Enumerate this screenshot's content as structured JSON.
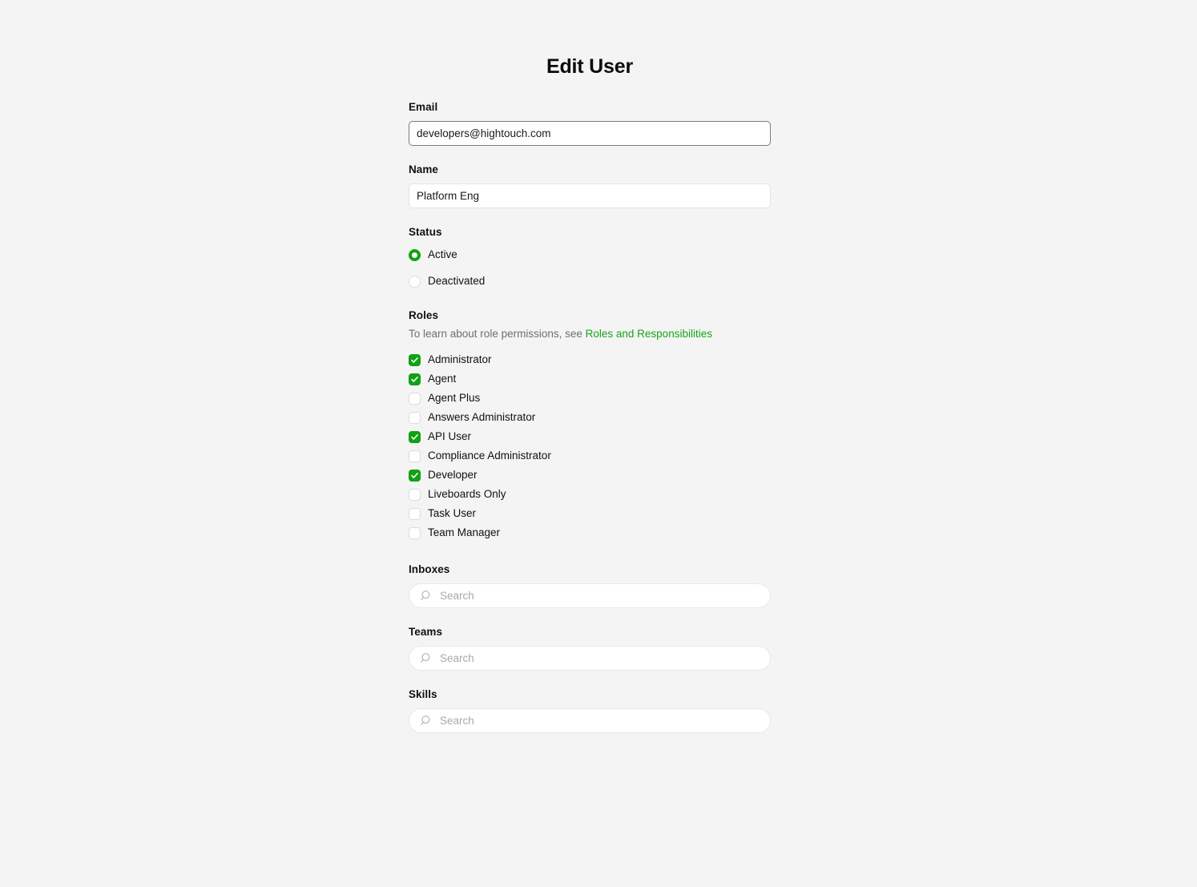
{
  "page": {
    "title": "Edit User",
    "background_color": "#f4f4f4",
    "accent_color": "#11a111",
    "link_color": "#17a617"
  },
  "email": {
    "label": "Email",
    "value": "developers@hightouch.com",
    "placeholder": ""
  },
  "name": {
    "label": "Name",
    "value": "Platform Eng",
    "placeholder": ""
  },
  "status": {
    "label": "Status",
    "selected": "Active",
    "options": [
      {
        "label": "Active",
        "checked": true
      },
      {
        "label": "Deactivated",
        "checked": false
      }
    ]
  },
  "roles": {
    "label": "Roles",
    "hint_prefix": "To learn about role permissions, see ",
    "hint_link": "Roles and Responsibilities",
    "items": [
      {
        "label": "Administrator",
        "checked": true
      },
      {
        "label": "Agent",
        "checked": true
      },
      {
        "label": "Agent Plus",
        "checked": false
      },
      {
        "label": "Answers Administrator",
        "checked": false
      },
      {
        "label": "API User",
        "checked": true
      },
      {
        "label": "Compliance Administrator",
        "checked": false
      },
      {
        "label": "Developer",
        "checked": true
      },
      {
        "label": "Liveboards Only",
        "checked": false
      },
      {
        "label": "Task User",
        "checked": false
      },
      {
        "label": "Team Manager",
        "checked": false
      }
    ]
  },
  "inboxes": {
    "label": "Inboxes",
    "search_placeholder": "Search",
    "search_value": "",
    "icon": "search-icon"
  },
  "teams": {
    "label": "Teams",
    "search_placeholder": "Search",
    "search_value": "",
    "icon": "search-icon"
  },
  "skills": {
    "label": "Skills",
    "search_placeholder": "Search",
    "search_value": "",
    "icon": "search-icon"
  }
}
